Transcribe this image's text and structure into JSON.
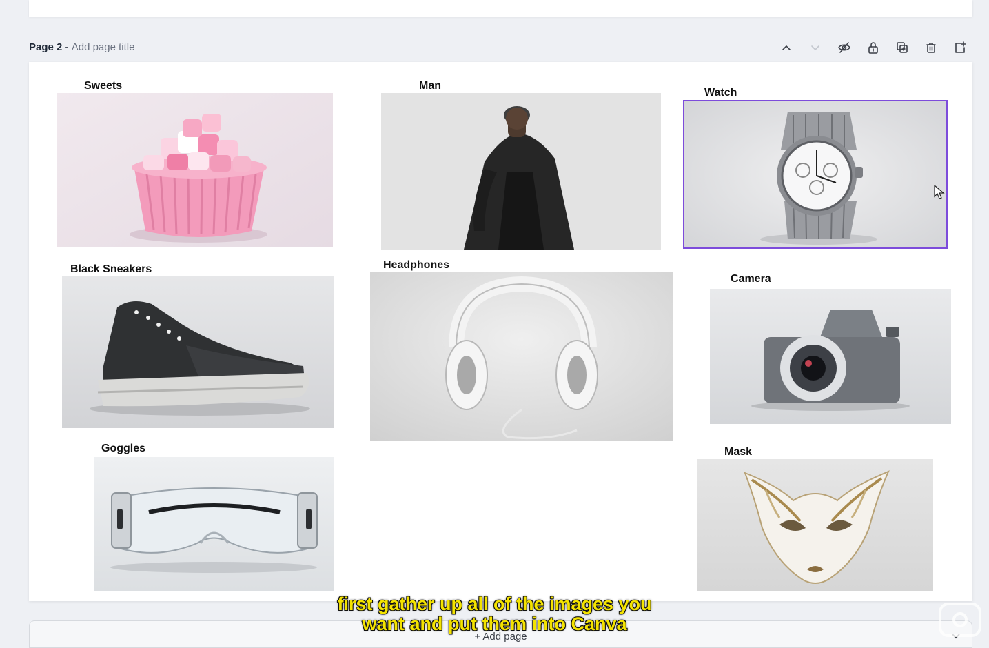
{
  "page": {
    "number_label": "Page 2",
    "separator": " - ",
    "title_placeholder": "Add page title"
  },
  "toolbar": [
    {
      "name": "move-page-up-button",
      "icon": "chevron-up-icon",
      "enabled": true
    },
    {
      "name": "move-page-down-button",
      "icon": "chevron-down-icon",
      "enabled": false
    },
    {
      "name": "hide-page-button",
      "icon": "eye-off-icon",
      "enabled": true
    },
    {
      "name": "lock-page-button",
      "icon": "lock-icon",
      "enabled": true
    },
    {
      "name": "duplicate-page-button",
      "icon": "duplicate-icon",
      "enabled": true
    },
    {
      "name": "delete-page-button",
      "icon": "trash-icon",
      "enabled": true
    },
    {
      "name": "add-page-button",
      "icon": "add-page-icon",
      "enabled": true
    }
  ],
  "items": [
    {
      "label": "Sweets"
    },
    {
      "label": "Man"
    },
    {
      "label": "Watch",
      "selected": true
    },
    {
      "label": "Black Sneakers"
    },
    {
      "label": "Headphones"
    },
    {
      "label": "Camera"
    },
    {
      "label": "Goggles"
    },
    {
      "label": "Mask"
    }
  ],
  "add_page": {
    "label": "+ Add page"
  },
  "subtitle": {
    "line1": "first gather up all of the images you",
    "line2": "want and put them into Canva"
  },
  "colors": {
    "selection": "#7d4cdb",
    "subtitle": "#f4e300",
    "canvas_bg": "#eef0f4"
  }
}
